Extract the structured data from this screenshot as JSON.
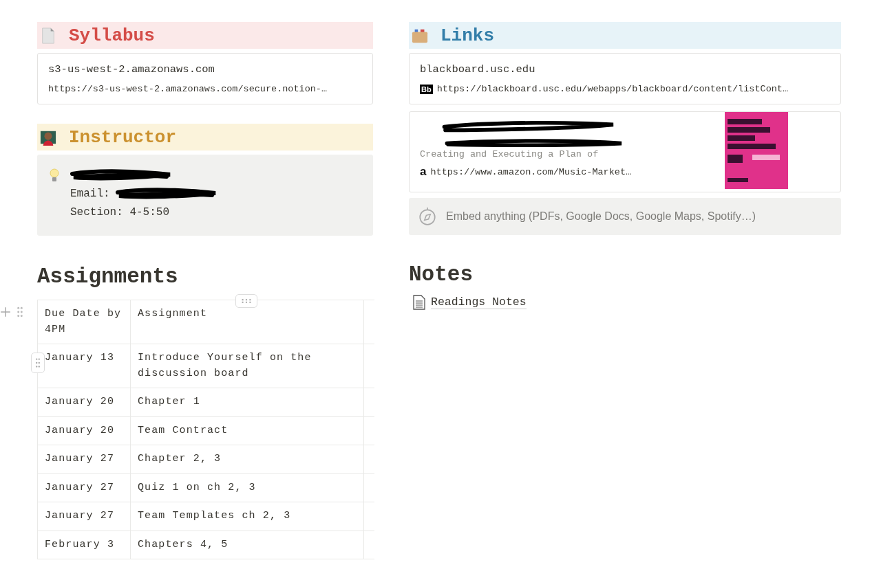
{
  "left": {
    "syllabus": {
      "title": "Syllabus",
      "bookmark": {
        "title": "s3-us-west-2.amazonaws.com",
        "url": "https://s3-us-west-2.amazonaws.com/secure.notion-…"
      }
    },
    "instructor": {
      "title": "Instructor",
      "callout": {
        "lines": [
          {
            "redacted": true
          },
          {
            "label": "Email:",
            "redacted": true
          },
          {
            "label": "Section: 4-5:50",
            "redacted": false
          }
        ]
      }
    },
    "assignments": {
      "title": "Assignments",
      "columns": [
        "Due Date by 4PM",
        "Assignment"
      ],
      "rows": [
        [
          "January 13",
          "Introduce Yourself on the discussion board"
        ],
        [
          "January 20",
          "Chapter 1"
        ],
        [
          "January 20",
          "Team Contract"
        ],
        [
          "January 27",
          "Chapter 2, 3"
        ],
        [
          "January 27",
          "Quiz 1 on ch 2, 3"
        ],
        [
          "January 27",
          "Team Templates ch 2, 3"
        ],
        [
          "February 3",
          "Chapters 4, 5"
        ]
      ]
    }
  },
  "right": {
    "links": {
      "title": "Links",
      "bookmarks": [
        {
          "kind": "blackboard",
          "title": "blackboard.usc.edu",
          "url": "https://blackboard.usc.edu/webapps/blackboard/content/listCont…",
          "favicon": "Bb"
        },
        {
          "kind": "amazon",
          "title_redacted": true,
          "description": "Creating and Executing a Plan of",
          "url": "https://www.amazon.com/Music-Market…",
          "favicon": "a"
        }
      ]
    },
    "embed": {
      "placeholder": "Embed anything (PDFs, Google Docs, Google Maps, Spotify…)"
    },
    "notes": {
      "title": "Notes",
      "pages": [
        "Readings Notes"
      ]
    }
  }
}
